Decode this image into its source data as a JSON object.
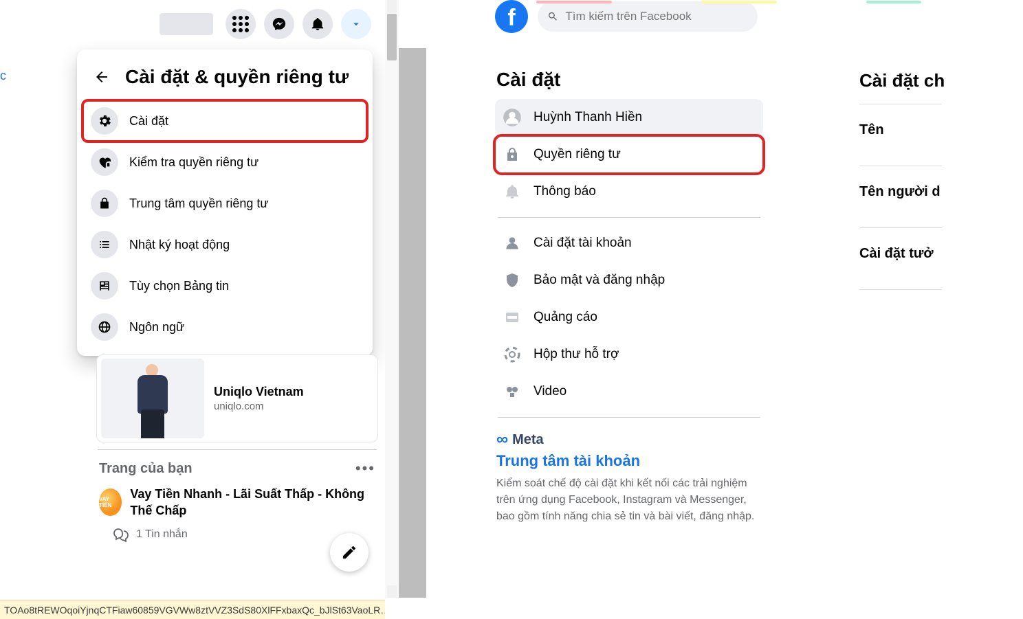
{
  "left": {
    "menu_title": "Cài đặt & quyền riêng tư",
    "items": [
      {
        "label": "Cài đặt",
        "icon": "gear",
        "highlighted": true
      },
      {
        "label": "Kiểm tra quyền riêng tư",
        "icon": "heart-lock"
      },
      {
        "label": "Trung tâm quyền riêng tư",
        "icon": "lock"
      },
      {
        "label": "Nhật ký hoạt động",
        "icon": "list"
      },
      {
        "label": "Tùy chọn Bảng tin",
        "icon": "news"
      },
      {
        "label": "Ngôn ngữ",
        "icon": "globe"
      }
    ],
    "ad": {
      "title": "Uniqlo Vietnam",
      "domain": "uniqlo.com"
    },
    "pages_section": "Trang của bạn",
    "page_item": "Vay Tiền Nhanh - Lãi Suất Thấp - Không Thế Chấp",
    "page_avatar_text": "VAY TIỀN",
    "message_count": "1 Tin nhắn",
    "status_bar": "TOAo8tREWOqoiYjnqCTFiaw60859VGVWw8ztVVZ3SdS80XlFFxbaxQc_bJlSt63VaoLR…",
    "address_fragment": "c"
  },
  "right": {
    "search_placeholder": "Tìm kiếm trên Facebook",
    "heading": "Cài đặt",
    "nav": [
      {
        "label": "Huỳnh Thanh Hiền",
        "icon": "avatar",
        "active": true
      },
      {
        "label": "Quyền riêng tư",
        "icon": "privacy",
        "highlighted": true
      },
      {
        "label": "Thông báo",
        "icon": "bell"
      },
      {
        "label": "Cài đặt tài khoản",
        "icon": "user-gear"
      },
      {
        "label": "Bảo mật và đăng nhập",
        "icon": "shield"
      },
      {
        "label": "Quảng cáo",
        "icon": "ad"
      },
      {
        "label": "Hộp thư hỗ trợ",
        "icon": "lifebuoy"
      },
      {
        "label": "Video",
        "icon": "film"
      }
    ],
    "meta_label": "Meta",
    "accounts_center": "Trung tâm tài khoản",
    "accounts_desc": "Kiểm soát chế độ cài đặt khi kết nối các trải nghiệm trên ứng dụng Facebook, Instagram và Messenger, bao gồm tính năng chia sẻ tin và bài viết, đăng nhập.",
    "detail_title": "Cài đặt ch",
    "detail_items": [
      "Tên",
      "Tên người d",
      "Cài đặt tưở"
    ]
  }
}
